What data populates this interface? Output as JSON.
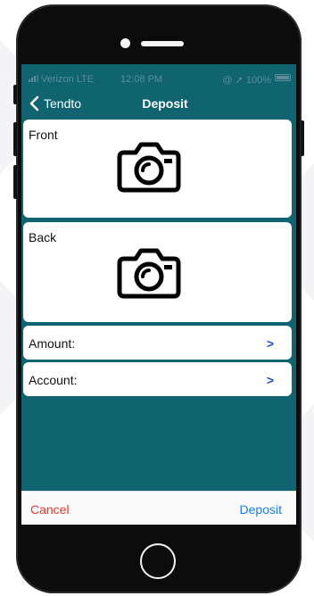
{
  "status_bar": {
    "carrier": "Verizon  LTE",
    "time": "12:08 PM",
    "indicators": "@ ➚ 100%",
    "battery_icon": "battery-icon"
  },
  "nav": {
    "back_label": "Tendto",
    "title": "Deposit"
  },
  "cards": {
    "front_label": "Front",
    "back_label": "Back",
    "front_icon": "camera-icon",
    "back_icon": "camera-icon"
  },
  "fields": {
    "amount_label": "Amount:",
    "account_label": "Account:",
    "chevron": ">"
  },
  "toolbar": {
    "cancel_label": "Cancel",
    "deposit_label": "Deposit"
  },
  "colors": {
    "screen_bg": "#0f6470",
    "cancel": "#e53a2d",
    "deposit": "#1a7ef0",
    "chevron": "#1f4bd8"
  }
}
